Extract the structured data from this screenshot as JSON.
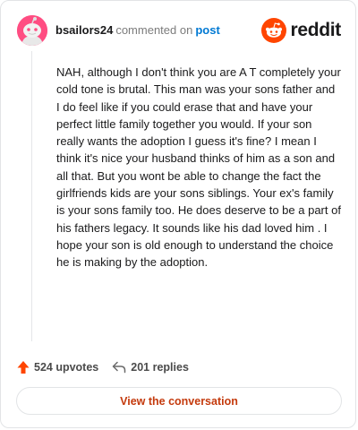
{
  "comment": {
    "username": "bsailors24",
    "action_text": "commented on",
    "post_link": "post",
    "body": "NAH, although I don't think you are A T completely your cold tone is brutal. This man was your sons father and I do feel like if you could erase that and have your perfect little family together you would. If your son really wants the adoption I guess it's fine? I mean I think it's nice your husband thinks of him as a son and all that. But you wont be able to change the fact the girlfriends kids are your sons siblings. Your ex's family is your sons family too. He does deserve to be a part of his fathers legacy. It sounds like his dad loved him . I hope your son is old enough to understand the choice he is making by the adoption."
  },
  "brand": {
    "name": "reddit",
    "icon": "reddit-snoo-icon",
    "color": "#ff4500"
  },
  "avatar": {
    "icon": "snoo-avatar-icon",
    "color": "#ff4d82"
  },
  "actions": {
    "upvotes": "524 upvotes",
    "replies": "201 replies",
    "upvote_icon": "upvote-arrow-icon",
    "reply_icon": "reply-arrow-icon"
  },
  "cta": {
    "label": "View the conversation",
    "color": "#c43a0d"
  }
}
